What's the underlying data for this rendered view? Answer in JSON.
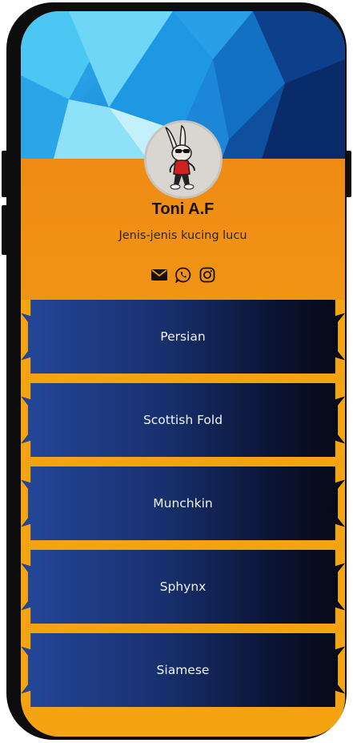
{
  "profile": {
    "name": "Toni A.F",
    "tagline": "Jenis-jenis kucing lucu"
  },
  "social_icons": [
    "email-icon",
    "whatsapp-icon",
    "instagram-icon"
  ],
  "links": [
    {
      "label": "Persian"
    },
    {
      "label": "Scottish Fold"
    },
    {
      "label": "Munchkin"
    },
    {
      "label": "Sphynx"
    },
    {
      "label": "Siamese"
    }
  ],
  "colors": {
    "accent_orange": "#f09414",
    "link_gradient_start": "#24479a",
    "link_gradient_end": "#060814",
    "banner_blue": "#1d8fde"
  }
}
